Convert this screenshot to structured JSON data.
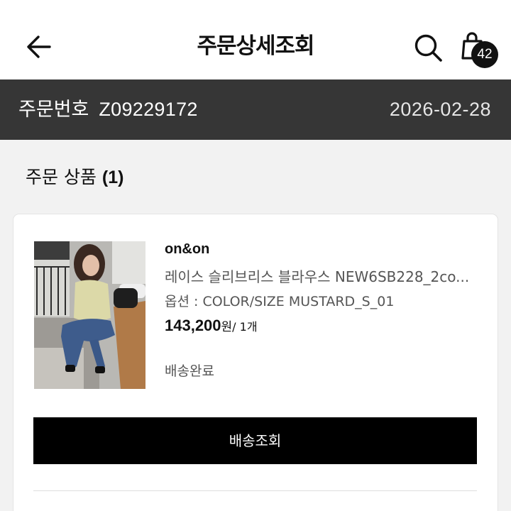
{
  "header": {
    "title": "주문상세조회",
    "cart_count": "42"
  },
  "order": {
    "label": "주문번호",
    "number": "Z09229172",
    "date": "2026-02-28"
  },
  "section": {
    "title": "주문 상품",
    "count": "(1)"
  },
  "item": {
    "brand": "on&on",
    "name": "레이스 슬리브리스 블라우스 NEW6SB228_2co...",
    "option": "옵션 : COLOR/SIZE MUSTARD_S_01",
    "price": "143,200",
    "price_unit": "원",
    "qty": "/ 1개",
    "status": "배송완료",
    "image_icon": "product-photo"
  },
  "actions": {
    "track_label": "배송조회"
  },
  "colors": {
    "order_bar_bg": "#363636",
    "button_bg": "#000000",
    "badge_bg": "#111111"
  }
}
